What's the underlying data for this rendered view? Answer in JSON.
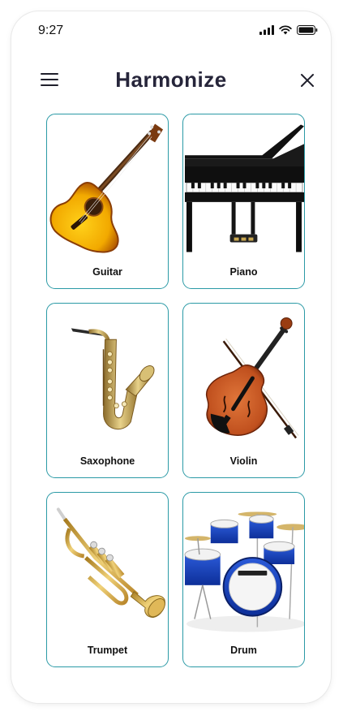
{
  "status_bar": {
    "time": "9:27",
    "icons": [
      "signal-icon",
      "wifi-icon",
      "battery-icon"
    ]
  },
  "header": {
    "title": "Harmonize",
    "menu_icon": "hamburger-menu-icon",
    "close_icon": "close-icon"
  },
  "instruments": [
    {
      "label": "Guitar",
      "icon": "guitar-image"
    },
    {
      "label": "Piano",
      "icon": "piano-image"
    },
    {
      "label": "Saxophone",
      "icon": "saxophone-image"
    },
    {
      "label": "Violin",
      "icon": "violin-image"
    },
    {
      "label": "Trumpet",
      "icon": "trumpet-image"
    },
    {
      "label": "Drum",
      "icon": "drum-kit-image"
    }
  ],
  "colors": {
    "card_border": "#2b9aa6",
    "title": "#26253a"
  }
}
